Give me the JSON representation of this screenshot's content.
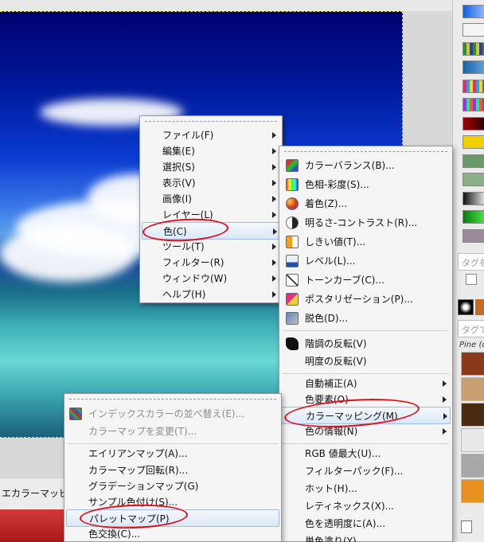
{
  "main_menu": {
    "items": [
      {
        "label": "ファイル(F)",
        "submenu": true
      },
      {
        "label": "編集(E)",
        "submenu": true
      },
      {
        "label": "選択(S)",
        "submenu": true
      },
      {
        "label": "表示(V)",
        "submenu": true
      },
      {
        "label": "画像(I)",
        "submenu": true
      },
      {
        "label": "レイヤー(L)",
        "submenu": true
      },
      {
        "label": "色(C)",
        "submenu": true,
        "highlighted": true
      },
      {
        "label": "ツール(T)",
        "submenu": true
      },
      {
        "label": "フィルター(R)",
        "submenu": true
      },
      {
        "label": "ウィンドウ(W)",
        "submenu": true
      },
      {
        "label": "ヘルプ(H)",
        "submenu": true
      }
    ]
  },
  "colors_menu": {
    "items": [
      {
        "label": "カラーバランス(B)...",
        "icon": "color-balance-icon"
      },
      {
        "label": "色相-彩度(S)...",
        "icon": "hue-saturation-icon"
      },
      {
        "label": "着色(Z)...",
        "icon": "colorize-icon"
      },
      {
        "label": "明るさ-コントラスト(R)...",
        "icon": "brightness-contrast-icon"
      },
      {
        "label": "しきい値(T)...",
        "icon": "threshold-icon"
      },
      {
        "label": "レベル(L)...",
        "icon": "levels-icon"
      },
      {
        "label": "トーンカーブ(C)...",
        "icon": "curves-icon"
      },
      {
        "label": "ポスタリゼーション(P)...",
        "icon": "posterize-icon"
      },
      {
        "label": "脱色(D)...",
        "icon": "desaturate-icon"
      },
      {
        "label": "階調の反転(V)",
        "icon": "invert-icon"
      },
      {
        "label": "明度の反転(V)"
      },
      {
        "label": "自動補正(A)",
        "submenu": true
      },
      {
        "label": "色要素(O)",
        "submenu": true
      },
      {
        "label": "カラーマッピング(M)",
        "submenu": true,
        "highlighted": true
      },
      {
        "label": "色の情報(N)",
        "submenu": true
      },
      {
        "label": "RGB 値最大(U)..."
      },
      {
        "label": "フィルターパック(F)..."
      },
      {
        "label": "ホット(H)..."
      },
      {
        "label": "レティネックス(X)..."
      },
      {
        "label": "色を透明度に(A)..."
      },
      {
        "label": "単色塗り(Y)..."
      }
    ]
  },
  "map_menu": {
    "items": [
      {
        "label": "インデックスカラーの並べ替え(E)...",
        "disabled": true,
        "icon": "rearrange-colormap-icon"
      },
      {
        "label": "カラーマップを変更(T)...",
        "disabled": true
      },
      {
        "label": "エイリアンマップ(A)..."
      },
      {
        "label": "カラーマップ回転(R)..."
      },
      {
        "label": "グラデーションマップ(G)"
      },
      {
        "label": "サンプル色付け(S)..."
      },
      {
        "label": "パレットマップ(P)",
        "highlighted": true
      },
      {
        "label": "色交換(C)..."
      }
    ]
  },
  "status": {
    "text": "エカラーマッピ"
  },
  "dock": {
    "tag_placeholder_1": "タグを",
    "tag_placeholder_2": "タグで",
    "brush_name": "Pine (c"
  }
}
